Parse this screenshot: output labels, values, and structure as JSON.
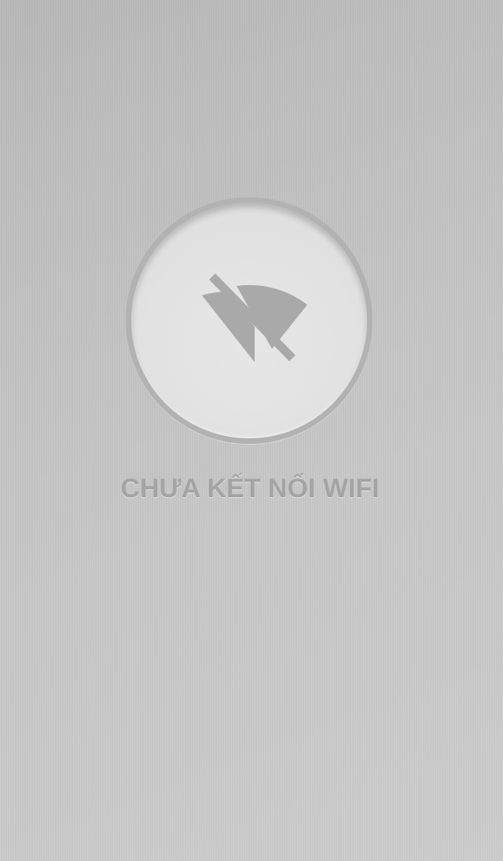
{
  "status": {
    "label": "CHƯA KẾT NỐI WIFI",
    "icon": "wifi-off-icon"
  },
  "colors": {
    "background": "#c4c4c4",
    "button_face": "#e3e3e3",
    "button_ring": "#b2b2b2",
    "icon": "#a9a9a9",
    "label": "#a4a4a4"
  }
}
